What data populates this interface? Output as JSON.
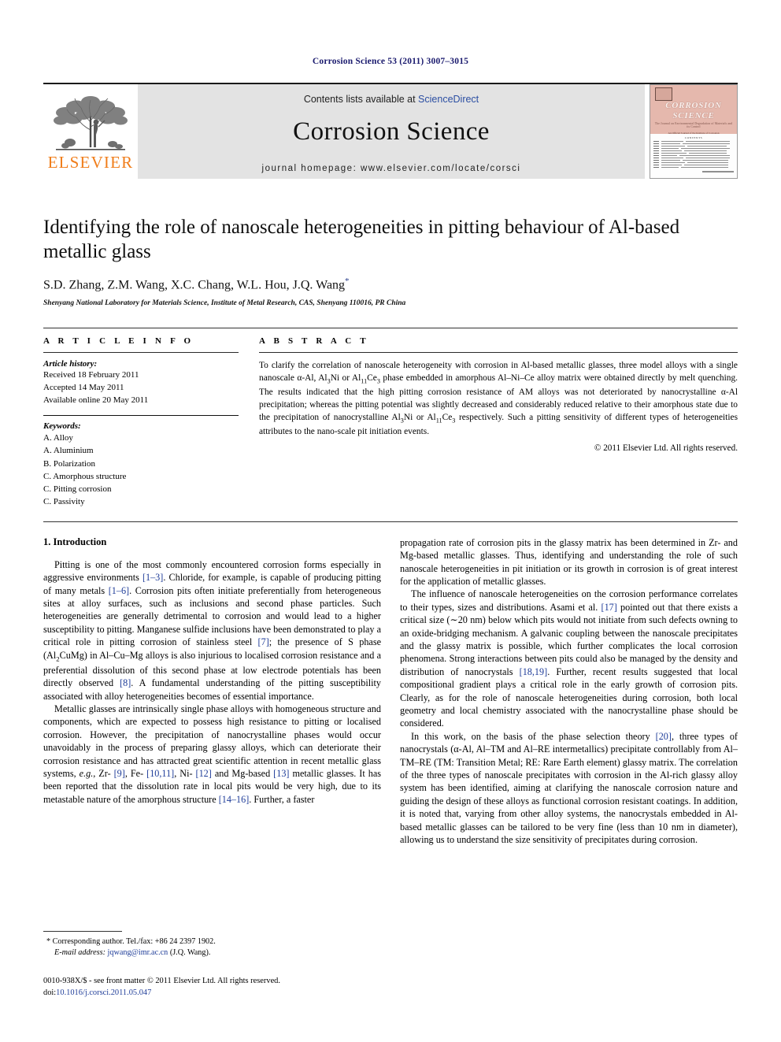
{
  "running_head": "Corrosion Science 53 (2011) 3007–3015",
  "masthead": {
    "publisher_name": "ELSEVIER",
    "contents_prefix": "Contents lists available at ",
    "contents_link": "ScienceDirect",
    "journal_title": "Corrosion Science",
    "homepage": "journal homepage: www.elsevier.com/locate/corsci",
    "cover": {
      "line1": "CORROSION",
      "line2": "SCIENCE",
      "subtitle": "The Journal on Environmental Degradation of Materials and its Control",
      "subtitle2": "An Official Journal of the Institute of Corrosion",
      "contents_label": "CONTENTS"
    }
  },
  "article": {
    "title": "Identifying the role of nanoscale heterogeneities in pitting behaviour of Al-based metallic glass",
    "authors": "S.D. Zhang, Z.M. Wang, X.C. Chang, W.L. Hou, J.Q. Wang",
    "corresponding_marker": "*",
    "affiliation": "Shenyang National Laboratory for Materials Science, Institute of Metal Research, CAS, Shenyang 110016, PR China"
  },
  "article_info": {
    "heading": "A R T I C L E   I N F O",
    "history_label": "Article history:",
    "history": [
      "Received 18 February 2011",
      "Accepted 14 May 2011",
      "Available online 20 May 2011"
    ],
    "keywords_label": "Keywords:",
    "keywords": [
      "A. Alloy",
      "A. Aluminium",
      "B. Polarization",
      "C. Amorphous structure",
      "C. Pitting corrosion",
      "C. Passivity"
    ]
  },
  "abstract": {
    "heading": "A B S T R A C T",
    "part1": "To clarify the correlation of nanoscale heterogeneity with corrosion in Al-based metallic glasses, three model alloys with a single nanoscale α-Al, Al",
    "sub1": "3",
    "part2": "Ni or Al",
    "sub2": "11",
    "part3": "Ce",
    "sub3": "3",
    "part4": " phase embedded in amorphous Al–Ni–Ce alloy matrix were obtained directly by melt quenching. The results indicated that the high pitting corrosion resistance of AM alloys was not deteriorated by nanocrystalline α-Al precipitation; whereas the pitting potential was slightly decreased and considerably reduced relative to their amorphous state due to the precipitation of nanocrystalline Al",
    "sub4": "3",
    "part5": "Ni or Al",
    "sub5": "11",
    "part6": "Ce",
    "sub6": "3",
    "part7": " respectively. Such a pitting sensitivity of different types of heterogeneities attributes to the nano-scale pit initiation events.",
    "copyright": "© 2011 Elsevier Ltd. All rights reserved."
  },
  "introduction": {
    "section_title": "1. Introduction",
    "p1_a": "Pitting is one of the most commonly encountered corrosion forms especially in aggressive environments ",
    "p1_r1": "[1–3]",
    "p1_b": ". Chloride, for example, is capable of producing pitting of many metals ",
    "p1_r2": "[1–6]",
    "p1_c": ". Corrosion pits often initiate preferentially from heterogeneous sites at alloy surfaces, such as inclusions and second phase particles. Such heterogeneities are generally detrimental to corrosion and would lead to a higher susceptibility to pitting. Manganese sulfide inclusions have been demonstrated to play a critical role in pitting corrosion of stainless steel ",
    "p1_r3": "[7]",
    "p1_d": "; the presence of S phase (Al",
    "p1_sub": "2",
    "p1_e": "CuMg) in Al–Cu–Mg alloys is also injurious to localised corrosion resistance and a preferential dissolution of this second phase at low electrode potentials has been directly observed ",
    "p1_r4": "[8]",
    "p1_f": ". A fundamental understanding of the pitting susceptibility associated with alloy heterogeneities becomes of essential importance.",
    "p2_a": "Metallic glasses are intrinsically single phase alloys with homogeneous structure and components, which are expected to possess high resistance to pitting or localised corrosion. However, the precipitation of nanocrystalline phases would occur unavoidably in the process of preparing glassy alloys, which can deteriorate their corrosion resistance and has attracted great scientific attention in recent metallic glass systems, ",
    "p2_eg": "e.g.",
    "p2_b": ", Zr- ",
    "p2_r1": "[9]",
    "p2_c": ", Fe- ",
    "p2_r2": "[10,11]",
    "p2_d": ", Ni- ",
    "p2_r3": "[12]",
    "p2_e": " and Mg-based ",
    "p2_r4": "[13]",
    "p2_f": " metallic glasses. It has been reported that the dissolution rate in local pits would be very high, due to its metastable nature of the amorphous structure ",
    "p2_r5": "[14–16]",
    "p2_g": ". Further, a faster",
    "p3_a": "propagation rate of corrosion pits in the glassy matrix has been determined in Zr- and Mg-based metallic glasses. Thus, identifying and understanding the role of such nanoscale heterogeneities in pit initiation or its growth in corrosion is of great interest for the application of metallic glasses.",
    "p4_a": "The influence of nanoscale heterogeneities on the corrosion performance correlates to their types, sizes and distributions. Asami et al. ",
    "p4_r1": "[17]",
    "p4_b": " pointed out that there exists a critical size (∼20 nm) below which pits would not initiate from such defects owning to an oxide-bridging mechanism. A galvanic coupling between the nanoscale precipitates and the glassy matrix is possible, which further complicates the local corrosion phenomena. Strong interactions between pits could also be managed by the density and distribution of nanocrystals ",
    "p4_r2": "[18,19]",
    "p4_c": ". Further, recent results suggested that local compositional gradient plays a critical role in the early growth of corrosion pits. Clearly, as for the role of nanoscale heterogeneities during corrosion, both local geometry and local chemistry associated with the nanocrystalline phase should be considered.",
    "p5_a": "In this work, on the basis of the phase selection theory ",
    "p5_r1": "[20]",
    "p5_b": ", three types of nanocrystals (α-Al, Al–TM and Al–RE intermetallics) precipitate controllably from Al–TM–RE (TM: Transition Metal; RE: Rare Earth element) glassy matrix. The correlation of the three types of nanoscale precipitates with corrosion in the Al-rich glassy alloy system has been identified, aiming at clarifying the nanoscale corrosion nature and guiding the design of these alloys as functional corrosion resistant coatings. In addition, it is noted that, varying from other alloy systems, the nanocrystals embedded in Al-based metallic glasses can be tailored to be very fine (less than 10 nm in diameter), allowing us to understand the size sensitivity of precipitates during corrosion."
  },
  "footnote": {
    "marker": "*",
    "corresponding": "Corresponding author. Tel./fax: +86 24 2397 1902.",
    "email_label": "E-mail address:",
    "email": "jqwang@imr.ac.cn",
    "email_suffix": "(J.Q. Wang)."
  },
  "imprint": {
    "line1": "0010-938X/$ - see front matter © 2011 Elsevier Ltd. All rights reserved.",
    "doi_label": "doi:",
    "doi": "10.1016/j.corsci.2011.05.047"
  }
}
